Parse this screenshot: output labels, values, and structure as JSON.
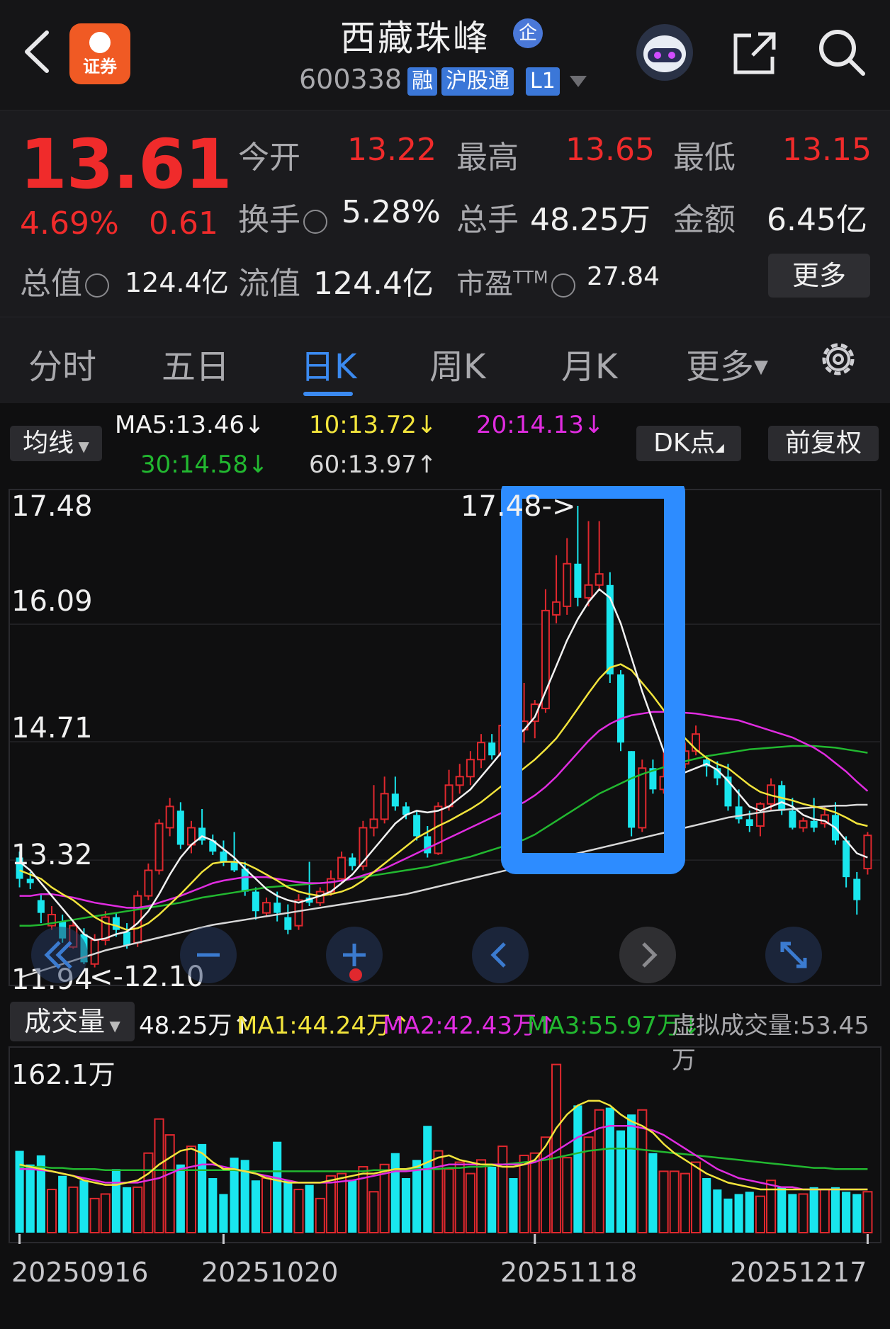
{
  "header": {
    "broker_logo_text": "证券",
    "stock_name": "西藏珠峰",
    "badge_text": "企",
    "stock_code": "600338",
    "tags": [
      "融",
      "沪股通",
      "L1"
    ]
  },
  "quote": {
    "price": "13.61",
    "change_pct": "4.69%",
    "change": "0.61",
    "open_label": "今开",
    "open": "13.22",
    "high_label": "最高",
    "high": "13.65",
    "low_label": "最低",
    "low": "13.15",
    "turnover_label": "换手",
    "turnover": "5.28%",
    "volume_label": "总手",
    "volume": "48.25万",
    "amount_label": "金额",
    "amount": "6.45亿",
    "mktcap_label": "总值",
    "mktcap": "124.4亿",
    "float_label": "流值",
    "float": "124.4亿",
    "pe_label": "市盈",
    "pe_sup": "TTM",
    "pe": "27.84",
    "more_label": "更多"
  },
  "tabs": [
    "分时",
    "五日",
    "日K",
    "周K",
    "月K",
    "更多"
  ],
  "active_tab": "日K",
  "ma_bar": {
    "selector_label": "均线",
    "ma5": "MA5:13.46↓",
    "ma10": "10:13.72↓",
    "ma20": "20:14.13↓",
    "ma30": "30:14.58↓",
    "ma60": "60:13.97↑",
    "dk_label": "DK点",
    "adjust_label": "前复权"
  },
  "price_axis": [
    "17.48",
    "16.09",
    "14.71",
    "13.32",
    "11.94"
  ],
  "high_marker": "17.48->",
  "low_marker": "<-12.10",
  "volume_bar": {
    "selector_label": "成交量",
    "vol": "48.25万↑",
    "ma1": "MA1:44.24万↑",
    "ma2": "MA2:42.43万↑",
    "ma3": "MA3:55.97万↓",
    "virtual": "虚拟成交量:53.45万"
  },
  "volume_axis_top": "162.1万",
  "dates": [
    "20250916",
    "20251020",
    "20251118",
    "20251217"
  ],
  "colors": {
    "up": "#e0282e",
    "down": "#19e6ee",
    "ma5": "#f2f2f2",
    "ma10": "#f2e43c",
    "ma20": "#e02ce0",
    "ma30": "#22b830",
    "ma60": "#d8d8d8",
    "highlight": "#2d8cff",
    "accent": "#3b8af0"
  },
  "icons": [
    "back-icon",
    "broker-logo-icon",
    "robot-avatar-icon",
    "share-icon",
    "search-icon",
    "settings-icon",
    "info-icon"
  ],
  "chart_data": {
    "type": "candlestick",
    "ylim": [
      11.94,
      17.48
    ],
    "candles": [
      [
        13.35,
        13.1,
        13.42,
        13.0
      ],
      [
        13.1,
        13.05,
        13.18,
        12.98
      ],
      [
        12.85,
        12.7,
        12.92,
        12.58
      ],
      [
        12.55,
        12.68,
        12.78,
        12.5
      ],
      [
        12.6,
        12.4,
        12.68,
        12.35
      ],
      [
        12.3,
        12.55,
        12.62,
        12.28
      ],
      [
        12.45,
        12.12,
        12.52,
        12.1
      ],
      [
        12.1,
        12.38,
        12.45,
        12.06
      ],
      [
        12.38,
        12.65,
        12.72,
        12.32
      ],
      [
        12.65,
        12.5,
        12.7,
        12.42
      ],
      [
        12.48,
        12.32,
        12.58,
        12.28
      ],
      [
        12.35,
        12.9,
        12.96,
        12.3
      ],
      [
        12.9,
        13.2,
        13.28,
        12.85
      ],
      [
        13.2,
        13.75,
        13.8,
        13.15
      ],
      [
        13.7,
        13.95,
        14.05,
        13.6
      ],
      [
        13.9,
        13.5,
        14.0,
        13.45
      ],
      [
        13.5,
        13.7,
        13.78,
        13.4
      ],
      [
        13.7,
        13.55,
        13.92,
        13.5
      ],
      [
        13.55,
        13.42,
        13.62,
        13.38
      ],
      [
        13.42,
        13.3,
        13.55,
        13.25
      ],
      [
        13.3,
        13.2,
        13.65,
        13.18
      ],
      [
        13.22,
        12.95,
        13.3,
        12.9
      ],
      [
        12.95,
        12.72,
        13.0,
        12.62
      ],
      [
        12.7,
        12.82,
        12.88,
        12.65
      ],
      [
        12.82,
        12.7,
        12.95,
        12.6
      ],
      [
        12.65,
        12.5,
        12.8,
        12.45
      ],
      [
        12.55,
        12.85,
        12.92,
        12.5
      ],
      [
        12.88,
        12.82,
        13.3,
        12.78
      ],
      [
        12.82,
        12.95,
        13.0,
        12.78
      ],
      [
        12.95,
        13.1,
        13.2,
        12.9
      ],
      [
        13.1,
        13.35,
        13.42,
        13.05
      ],
      [
        13.35,
        13.25,
        13.4,
        13.2
      ],
      [
        13.25,
        13.7,
        13.78,
        13.2
      ],
      [
        13.7,
        13.8,
        14.2,
        13.6
      ],
      [
        13.8,
        14.1,
        14.3,
        13.75
      ],
      [
        14.1,
        13.95,
        14.3,
        13.9
      ],
      [
        13.95,
        13.85,
        14.0,
        13.8
      ],
      [
        13.85,
        13.6,
        13.9,
        13.55
      ],
      [
        13.6,
        13.4,
        13.72,
        13.35
      ],
      [
        13.4,
        13.95,
        14.0,
        13.38
      ],
      [
        13.95,
        14.2,
        14.38,
        13.9
      ],
      [
        14.2,
        14.3,
        14.45,
        14.1
      ],
      [
        14.3,
        14.5,
        14.6,
        14.2
      ],
      [
        14.5,
        14.7,
        14.8,
        14.4
      ],
      [
        14.7,
        14.55,
        14.8,
        14.5
      ],
      [
        14.55,
        14.9,
        15.0,
        14.5
      ],
      [
        14.9,
        14.85,
        15.5,
        14.8
      ],
      [
        14.85,
        14.95,
        15.4,
        14.7
      ],
      [
        14.95,
        15.15,
        15.2,
        14.75
      ],
      [
        15.1,
        16.25,
        16.5,
        15.05
      ],
      [
        16.2,
        16.35,
        16.9,
        16.1
      ],
      [
        16.3,
        16.8,
        17.1,
        16.2
      ],
      [
        16.8,
        16.4,
        17.48,
        16.3
      ],
      [
        16.4,
        16.55,
        17.3,
        16.3
      ],
      [
        16.55,
        16.68,
        17.3,
        16.5
      ],
      [
        16.55,
        15.5,
        16.7,
        15.4
      ],
      [
        15.5,
        14.7,
        15.55,
        14.6
      ],
      [
        14.6,
        13.7,
        14.6,
        13.6
      ],
      [
        13.7,
        14.4,
        14.5,
        13.65
      ],
      [
        14.4,
        14.15,
        14.5,
        14.1
      ],
      [
        14.15,
        14.3,
        14.6,
        14.1
      ],
      [
        14.3,
        14.45,
        14.6,
        14.15
      ],
      [
        14.45,
        14.6,
        14.7,
        14.4
      ],
      [
        14.6,
        14.8,
        14.9,
        14.55
      ],
      [
        14.5,
        14.42,
        14.55,
        14.3
      ],
      [
        14.4,
        14.28,
        14.48,
        14.2
      ],
      [
        14.3,
        13.95,
        14.45,
        13.9
      ],
      [
        13.95,
        13.8,
        14.15,
        13.75
      ],
      [
        13.8,
        13.72,
        13.9,
        13.65
      ],
      [
        13.72,
        13.98,
        14.0,
        13.6
      ],
      [
        13.98,
        14.2,
        14.28,
        13.9
      ],
      [
        14.2,
        13.9,
        14.25,
        13.85
      ],
      [
        13.9,
        13.7,
        14.05,
        13.68
      ],
      [
        13.7,
        13.78,
        13.82,
        13.65
      ],
      [
        13.78,
        13.7,
        14.05,
        13.65
      ],
      [
        13.75,
        13.85,
        13.95,
        13.7
      ],
      [
        13.85,
        13.55,
        14.0,
        13.5
      ],
      [
        13.55,
        13.12,
        13.6,
        13.0
      ],
      [
        13.1,
        12.85,
        13.18,
        12.68
      ],
      [
        13.22,
        13.61,
        13.65,
        13.15
      ]
    ],
    "ma5": [
      13.3,
      13.2,
      13.05,
      12.9,
      12.75,
      12.6,
      12.45,
      12.38,
      12.4,
      12.45,
      12.48,
      12.58,
      12.72,
      12.92,
      13.15,
      13.35,
      13.5,
      13.6,
      13.55,
      13.45,
      13.35,
      13.22,
      13.1,
      12.98,
      12.9,
      12.85,
      12.82,
      12.86,
      12.9,
      12.95,
      13.05,
      13.15,
      13.3,
      13.45,
      13.6,
      13.75,
      13.85,
      13.9,
      13.88,
      13.9,
      13.95,
      14.05,
      14.15,
      14.3,
      14.45,
      14.6,
      14.75,
      14.85,
      15.0,
      15.3,
      15.6,
      15.9,
      16.15,
      16.35,
      16.5,
      16.4,
      16.1,
      15.7,
      15.3,
      14.95,
      14.6,
      14.4,
      14.35,
      14.4,
      14.45,
      14.38,
      14.25,
      14.1,
      13.95,
      13.9,
      13.95,
      14.0,
      13.95,
      13.85,
      13.8,
      13.78,
      13.7,
      13.55,
      13.4,
      13.35
    ],
    "ma10": [
      13.2,
      13.15,
      13.1,
      13.0,
      12.92,
      12.85,
      12.75,
      12.65,
      12.58,
      12.55,
      12.5,
      12.52,
      12.58,
      12.68,
      12.8,
      12.92,
      13.05,
      13.18,
      13.28,
      13.3,
      13.3,
      13.28,
      13.22,
      13.15,
      13.08,
      13.0,
      12.95,
      12.92,
      12.9,
      12.92,
      12.95,
      13.0,
      13.08,
      13.18,
      13.28,
      13.38,
      13.48,
      13.58,
      13.65,
      13.72,
      13.78,
      13.85,
      13.92,
      14.0,
      14.1,
      14.2,
      14.3,
      14.4,
      14.5,
      14.62,
      14.75,
      14.92,
      15.1,
      15.28,
      15.45,
      15.58,
      15.62,
      15.55,
      15.4,
      15.25,
      15.08,
      14.92,
      14.75,
      14.62,
      14.52,
      14.45,
      14.4,
      14.3,
      14.2,
      14.12,
      14.08,
      14.05,
      14.02,
      13.98,
      13.95,
      13.92,
      13.88,
      13.82,
      13.75,
      13.72
    ],
    "ma20": [
      12.9,
      12.9,
      12.92,
      12.92,
      12.9,
      12.88,
      12.85,
      12.82,
      12.8,
      12.78,
      12.76,
      12.76,
      12.78,
      12.82,
      12.86,
      12.9,
      12.95,
      13.0,
      13.05,
      13.08,
      13.1,
      13.12,
      13.12,
      13.12,
      13.1,
      13.08,
      13.06,
      13.05,
      13.05,
      13.06,
      13.08,
      13.1,
      13.14,
      13.18,
      13.22,
      13.28,
      13.34,
      13.4,
      13.46,
      13.52,
      13.58,
      13.64,
      13.7,
      13.76,
      13.82,
      13.88,
      13.94,
      14.0,
      14.08,
      14.18,
      14.3,
      14.44,
      14.58,
      14.72,
      14.84,
      14.92,
      14.98,
      15.02,
      15.04,
      15.06,
      15.06,
      15.06,
      15.05,
      15.04,
      15.02,
      15.0,
      14.98,
      14.96,
      14.92,
      14.88,
      14.84,
      14.8,
      14.76,
      14.7,
      14.64,
      14.56,
      14.46,
      14.36,
      14.24,
      14.13
    ],
    "ma30": [
      12.55,
      12.55,
      12.56,
      12.58,
      12.6,
      12.62,
      12.64,
      12.66,
      12.68,
      12.7,
      12.72,
      12.74,
      12.76,
      12.78,
      12.8,
      12.82,
      12.85,
      12.88,
      12.9,
      12.92,
      12.94,
      12.96,
      12.98,
      13.0,
      13.01,
      13.02,
      13.03,
      13.04,
      13.05,
      13.06,
      13.08,
      13.1,
      13.12,
      13.14,
      13.16,
      13.18,
      13.2,
      13.22,
      13.24,
      13.27,
      13.3,
      13.33,
      13.36,
      13.4,
      13.44,
      13.48,
      13.52,
      13.56,
      13.62,
      13.7,
      13.78,
      13.86,
      13.94,
      14.02,
      14.1,
      14.16,
      14.22,
      14.28,
      14.33,
      14.37,
      14.41,
      14.45,
      14.48,
      14.51,
      14.54,
      14.56,
      14.58,
      14.6,
      14.62,
      14.63,
      14.64,
      14.65,
      14.66,
      14.66,
      14.66,
      14.65,
      14.64,
      14.62,
      14.6,
      14.58
    ],
    "ma60": [
      11.94,
      11.98,
      12.02,
      12.06,
      12.1,
      12.14,
      12.18,
      12.22,
      12.26,
      12.29,
      12.32,
      12.35,
      12.38,
      12.41,
      12.44,
      12.47,
      12.5,
      12.53,
      12.56,
      12.58,
      12.6,
      12.62,
      12.64,
      12.66,
      12.68,
      12.7,
      12.72,
      12.74,
      12.76,
      12.78,
      12.8,
      12.82,
      12.84,
      12.86,
      12.88,
      12.9,
      12.92,
      12.95,
      12.98,
      13.01,
      13.04,
      13.07,
      13.1,
      13.13,
      13.16,
      13.19,
      13.22,
      13.25,
      13.28,
      13.31,
      13.34,
      13.37,
      13.4,
      13.43,
      13.46,
      13.49,
      13.52,
      13.55,
      13.58,
      13.61,
      13.64,
      13.67,
      13.7,
      13.73,
      13.76,
      13.79,
      13.82,
      13.84,
      13.86,
      13.88,
      13.9,
      13.91,
      13.92,
      13.93,
      13.94,
      13.95,
      13.96,
      13.96,
      13.97,
      13.97
    ],
    "volume_ylim": [
      0,
      162.1
    ],
    "volumes": [
      72,
      60,
      68,
      38,
      50,
      40,
      46,
      30,
      34,
      56,
      40,
      40,
      70,
      100,
      86,
      60,
      76,
      78,
      48,
      34,
      66,
      64,
      46,
      48,
      80,
      46,
      38,
      42,
      30,
      50,
      52,
      46,
      58,
      36,
      60,
      70,
      48,
      64,
      94,
      72,
      56,
      62,
      52,
      64,
      58,
      76,
      48,
      68,
      70,
      84,
      148,
      66,
      112,
      84,
      108,
      110,
      90,
      104,
      108,
      70,
      54,
      54,
      52,
      62,
      48,
      38,
      30,
      34,
      36,
      32,
      46,
      40,
      34,
      34,
      40,
      38,
      40,
      36,
      34,
      36
    ],
    "vol_ma1": [
      60,
      58,
      56,
      54,
      52,
      50,
      46,
      44,
      42,
      42,
      44,
      46,
      52,
      60,
      66,
      72,
      74,
      70,
      62,
      56,
      56,
      54,
      52,
      48,
      46,
      44,
      44,
      44,
      44,
      46,
      48,
      50,
      52,
      52,
      54,
      56,
      56,
      58,
      62,
      66,
      68,
      64,
      62,
      60,
      60,
      58,
      58,
      60,
      64,
      76,
      92,
      104,
      112,
      116,
      116,
      112,
      104,
      98,
      94,
      88,
      78,
      70,
      64,
      58,
      52,
      48,
      44,
      42,
      40,
      38,
      38,
      38,
      38,
      38,
      38,
      38,
      38,
      38,
      38,
      38
    ],
    "vol_ma2": [
      56,
      56,
      55,
      54,
      52,
      50,
      48,
      46,
      44,
      44,
      44,
      44,
      46,
      48,
      52,
      56,
      58,
      60,
      60,
      58,
      56,
      54,
      52,
      50,
      48,
      46,
      44,
      44,
      44,
      44,
      45,
      46,
      48,
      50,
      52,
      54,
      54,
      55,
      56,
      58,
      60,
      60,
      60,
      60,
      60,
      60,
      60,
      60,
      62,
      66,
      72,
      78,
      84,
      88,
      92,
      94,
      94,
      94,
      92,
      90,
      86,
      80,
      74,
      68,
      62,
      56,
      52,
      48,
      46,
      44,
      42,
      40,
      40,
      38,
      38,
      38,
      38,
      38,
      38,
      38
    ],
    "vol_ma3": [
      58,
      58,
      58,
      57,
      57,
      56,
      56,
      56,
      55,
      55,
      55,
      55,
      55,
      55,
      55,
      55,
      55,
      55,
      55,
      55,
      55,
      54,
      54,
      54,
      54,
      54,
      54,
      54,
      54,
      54,
      54,
      54,
      54,
      55,
      55,
      55,
      55,
      56,
      56,
      56,
      57,
      57,
      58,
      58,
      59,
      60,
      61,
      62,
      63,
      64,
      66,
      68,
      70,
      72,
      73,
      74,
      74,
      74,
      73,
      72,
      71,
      70,
      69,
      68,
      67,
      66,
      65,
      64,
      63,
      62,
      61,
      60,
      59,
      58,
      57,
      57,
      56,
      56,
      56,
      56
    ]
  }
}
